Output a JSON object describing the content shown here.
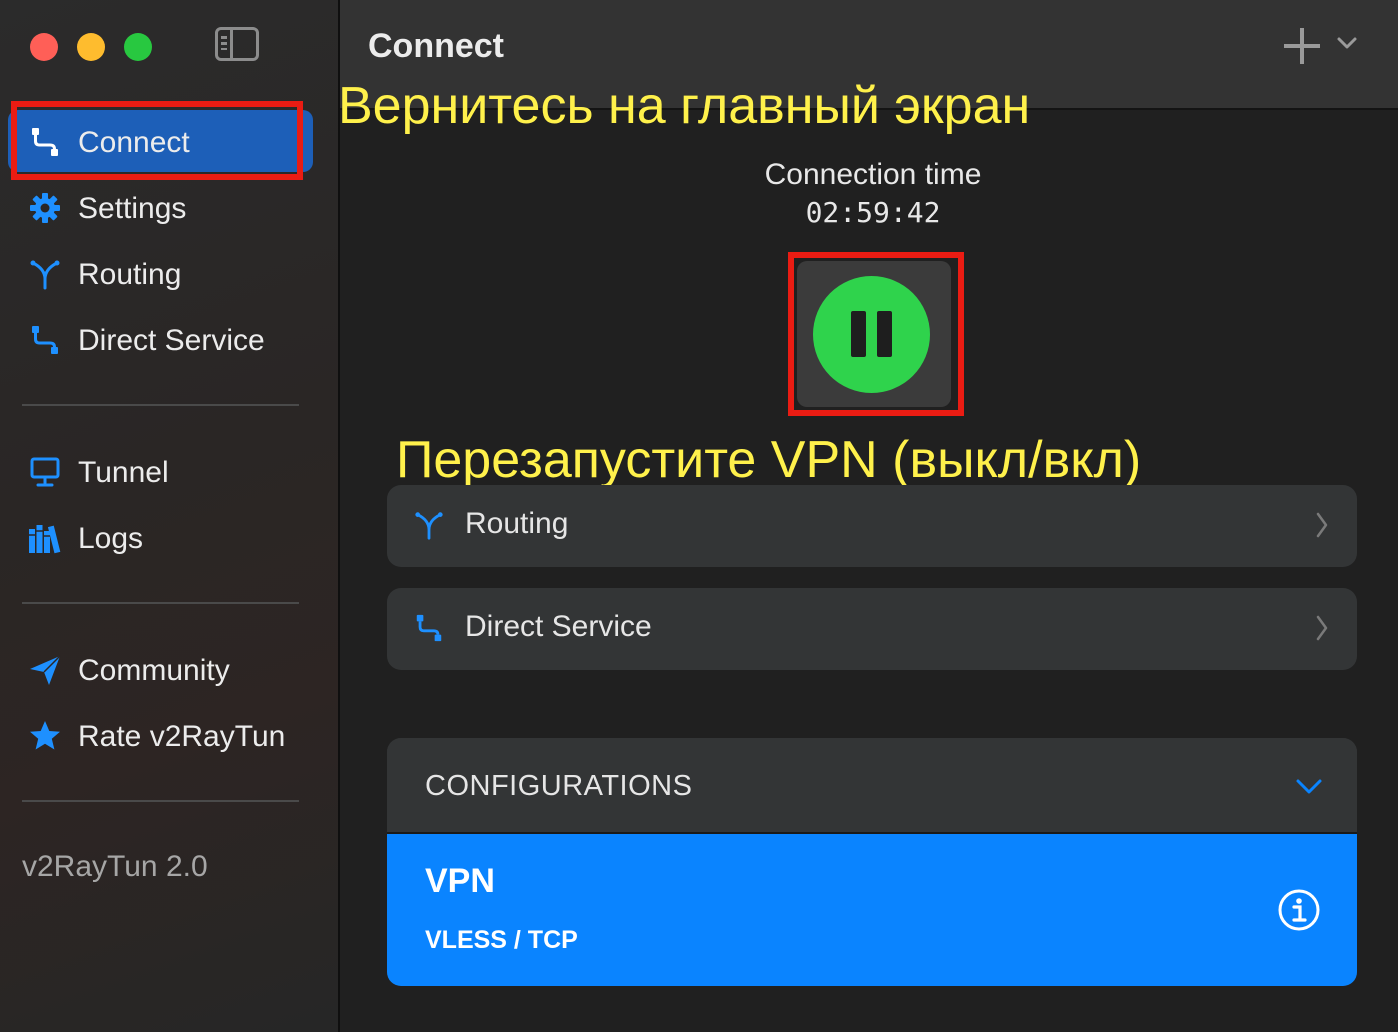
{
  "window": {
    "traffic_lights": {
      "close": "#ff5f57",
      "minimize": "#febc2e",
      "maximize": "#28c840"
    },
    "sidebar_toggle_icon": "sidebar-icon"
  },
  "sidebar": {
    "items": [
      {
        "label": "Connect",
        "icon": "connect-icon",
        "active": true
      },
      {
        "label": "Settings",
        "icon": "gear-icon"
      },
      {
        "label": "Routing",
        "icon": "routing-icon"
      },
      {
        "label": "Direct Service",
        "icon": "connect-icon"
      },
      {
        "label": "Tunnel",
        "icon": "monitor-icon"
      },
      {
        "label": "Logs",
        "icon": "books-icon"
      },
      {
        "label": "Community",
        "icon": "paper-plane-icon"
      },
      {
        "label": "Rate v2RayTun",
        "icon": "star-icon"
      }
    ],
    "version": "v2RayTun 2.0"
  },
  "header": {
    "title": "Connect",
    "add_icon": "plus-icon",
    "menu_icon": "chevron-down-icon"
  },
  "connection": {
    "label": "Connection time",
    "time": "02:59:42",
    "state_icon": "pause-icon"
  },
  "annotations": {
    "top": "Вернитесь на главный экран",
    "middle": "Перезапустите VPN (выкл/вкл)"
  },
  "cards": [
    {
      "label": "Routing",
      "icon": "routing-icon"
    },
    {
      "label": "Direct Service",
      "icon": "connect-icon"
    }
  ],
  "configurations": {
    "title": "CONFIGURATIONS",
    "items": [
      {
        "name": "VPN",
        "protocol": "VLESS / TCP",
        "selected": true
      }
    ]
  },
  "colors": {
    "accent": "#0a84ff",
    "active_nav": "#1d5fb8",
    "play_button": "#2fd34c",
    "highlight_box": "#ea1c13",
    "annotation_text": "#fff14b"
  }
}
